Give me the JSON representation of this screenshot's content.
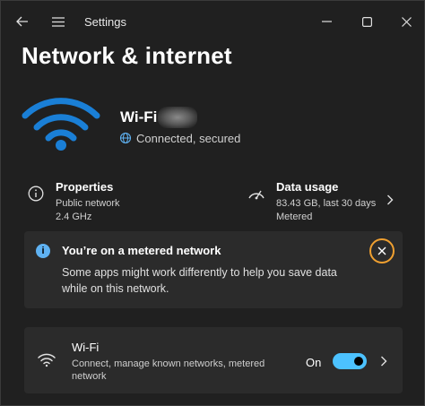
{
  "titlebar": {
    "title": "Settings"
  },
  "page": {
    "title": "Network & internet"
  },
  "hero": {
    "name": "Wi-Fi",
    "status": "Connected, secured"
  },
  "properties": {
    "title": "Properties",
    "lines": [
      "Public network",
      "2.4 GHz"
    ]
  },
  "data_usage": {
    "title": "Data usage",
    "lines": [
      "83.43 GB, last 30 days",
      "Metered"
    ]
  },
  "banner": {
    "title": "You’re on a metered network",
    "body": "Some apps might work differently to help you save data while on this network."
  },
  "wifi_row": {
    "title": "Wi-Fi",
    "subtitle": "Connect, manage known networks, metered network",
    "state": "On",
    "toggle_on": true
  },
  "colors": {
    "accent": "#4cc2ff",
    "wifi_hero": "#1a7fd6",
    "info": "#5fb2f2",
    "close_ring": "#f0a030"
  },
  "icons": [
    "back-arrow-icon",
    "hamburger-icon",
    "minimize-icon",
    "maximize-icon",
    "close-icon",
    "wifi-icon",
    "globe-icon",
    "info-icon",
    "gauge-icon",
    "chevron-right-icon"
  ]
}
